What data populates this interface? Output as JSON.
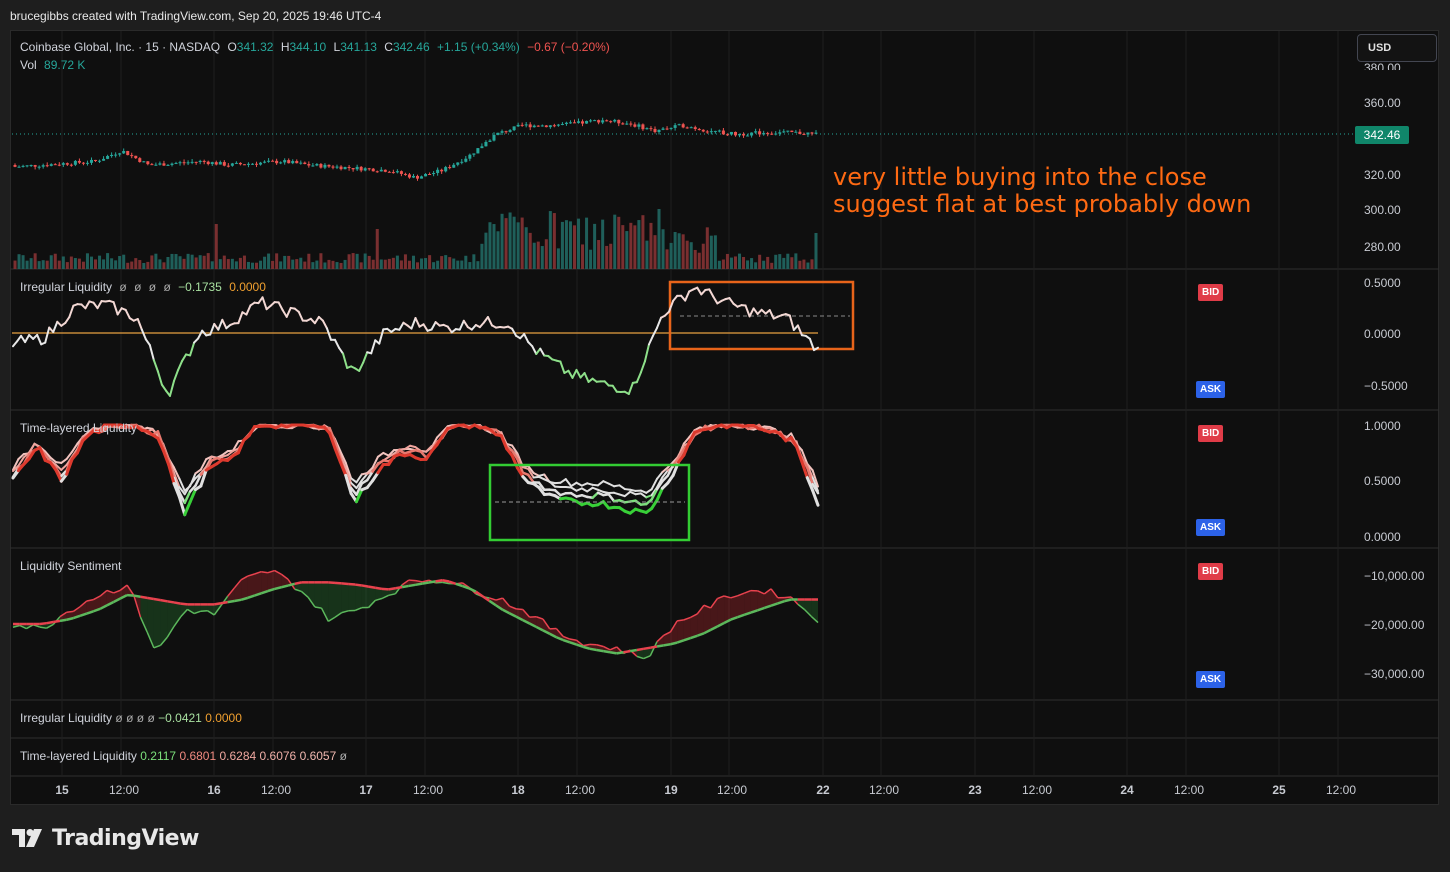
{
  "header": {
    "text": "brucegibbs created with TradingView.com, Sep 20, 2025 19:46 UTC-4"
  },
  "symbol": {
    "name": "Coinbase Global, Inc. · 15 · NASDAQ",
    "o_label": "O",
    "o": "341.32",
    "h_label": "H",
    "h": "344.10",
    "l_label": "L",
    "l": "341.13",
    "c_label": "C",
    "c": "342.46",
    "change": "+1.15 (+0.34%)",
    "change2": "−0.67 (−0.20%)",
    "vol_label": "Vol",
    "vol": "89.72 K"
  },
  "currency_button": "USD",
  "last_price": "342.46",
  "price_axis": [
    "380.00",
    "360.00",
    "320.00",
    "300.00",
    "280.00"
  ],
  "annotation": {
    "line1": "very little buying into the close",
    "line2": "suggest flat at best probably down"
  },
  "panels": {
    "irregular": {
      "title": "Irregular Liquidity",
      "vals": [
        "ø",
        "ø",
        "ø",
        "ø"
      ],
      "v1": "−0.1735",
      "v2": "0.0000",
      "axis": [
        "0.5000",
        "0.0000",
        "−0.5000"
      ]
    },
    "timelayered": {
      "title": "Time-layered Liquidity",
      "axis": [
        "1.0000",
        "0.5000",
        "0.0000"
      ]
    },
    "sentiment": {
      "title": "Liquidity Sentiment",
      "axis": [
        "−10,000.00",
        "−20,000.00",
        "−30,000.00"
      ]
    }
  },
  "badges": {
    "bid": "BID",
    "ask": "ASK"
  },
  "collapsed": {
    "irregular": {
      "title": "Irregular Liquidity",
      "vals": [
        "ø",
        "ø",
        "ø",
        "ø"
      ],
      "v1": "−0.0421",
      "v2": "0.0000"
    },
    "timelayered": {
      "title": "Time-layered Liquidity",
      "v1": "0.2117",
      "v2": "0.6801",
      "v3": "0.6284",
      "v4": "0.6076",
      "v5": "0.6057",
      "v6": "ø"
    }
  },
  "time_axis": [
    "15",
    "12:00",
    "16",
    "12:00",
    "17",
    "12:00",
    "18",
    "12:00",
    "19",
    "12:00",
    "22",
    "12:00",
    "23",
    "12:00",
    "24",
    "12:00",
    "25",
    "12:00"
  ],
  "brand": "TradingView",
  "colors": {
    "up": "#26a69a",
    "down": "#ef5350",
    "orange": "#ff6a13",
    "green_box": "#2ecc2e",
    "bid": "#e03c48",
    "ask": "#2c62e8"
  },
  "chart_data": [
    {
      "type": "candlestick",
      "title": "Coinbase Global, Inc. · 15 · NASDAQ",
      "ylim": [
        270,
        385
      ],
      "close_path": [
        324,
        325,
        326,
        327,
        333,
        325,
        326,
        327,
        325,
        326,
        327,
        325,
        324,
        323,
        322,
        318,
        322,
        330,
        342,
        347,
        347,
        348,
        350,
        348,
        344,
        347,
        344,
        342,
        343,
        343,
        342.46
      ],
      "last": 342.46
    },
    {
      "type": "bar",
      "title": "Vol",
      "last": "89.72 K"
    },
    {
      "type": "line",
      "title": "Irregular Liquidity",
      "ylim": [
        -0.65,
        0.55
      ],
      "series": [
        {
          "values": [
            -0.1,
            -0.05,
            0.25,
            0.28,
            0.15,
            -0.6,
            0.0,
            0.1,
            0.3,
            0.2,
            0.1,
            -0.4,
            0.0,
            0.1,
            0.05,
            0.1,
            0.1,
            -0.2,
            -0.4,
            -0.5,
            -0.55,
            0.2,
            0.45,
            0.3,
            0.2,
            0.15,
            -0.17
          ]
        }
      ]
    },
    {
      "type": "line",
      "title": "Time-layered Liquidity",
      "ylim": [
        0,
        1
      ]
    },
    {
      "type": "area",
      "title": "Liquidity Sentiment",
      "ylim": [
        -33000,
        -8000
      ]
    }
  ]
}
